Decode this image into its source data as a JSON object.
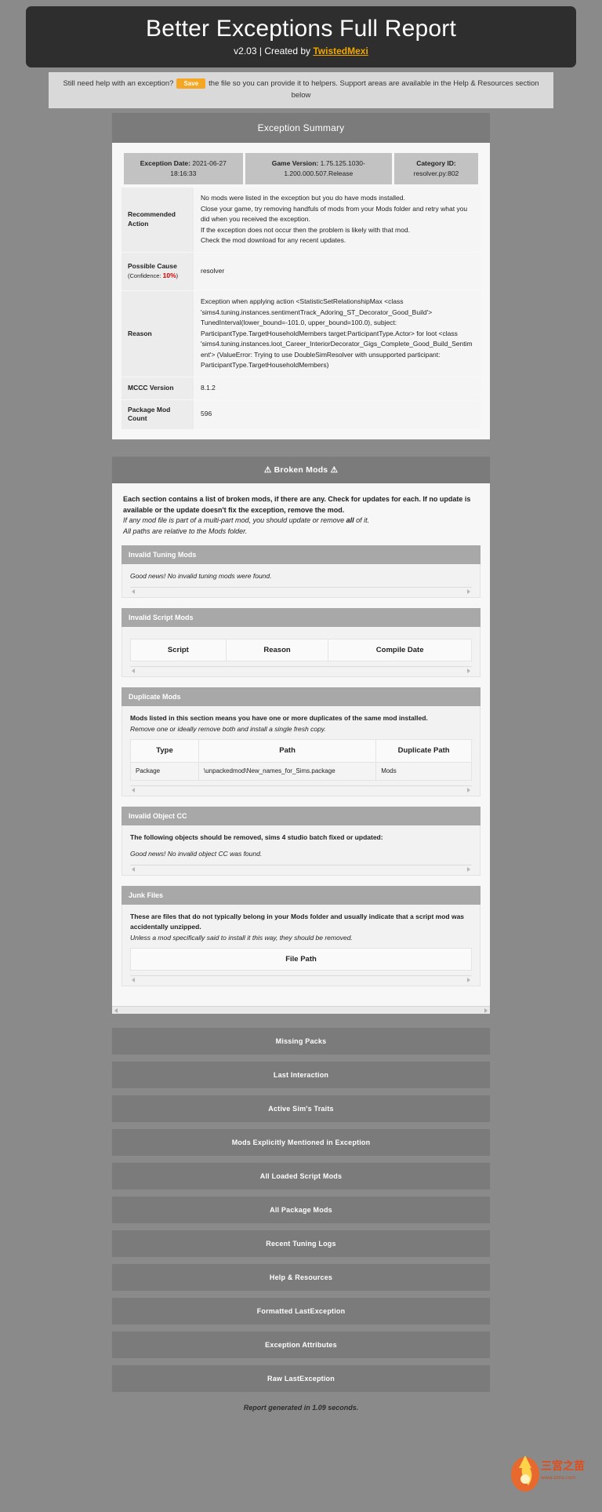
{
  "banner": {
    "title": "Better Exceptions Full Report",
    "version": "v2.03 | Created by ",
    "author": "TwistedMexi"
  },
  "help_strip": {
    "text_before": "Still need help with an exception?",
    "save_label": "Save",
    "text_after": "the file so you can provide it to helpers. Support areas are available in the Help & Resources section below"
  },
  "summary": {
    "heading": "Exception Summary",
    "meta": [
      {
        "label": "Exception Date:",
        "value": "2021-06-27 18:16:33"
      },
      {
        "label": "Game Version:",
        "value": "1.75.125.1030-1.200.000.507.Release"
      },
      {
        "label": "Category ID:",
        "value": "resolver.py:802"
      }
    ],
    "rows": [
      {
        "label": "Recommended Action",
        "value": "No mods were listed in the exception but you do have mods installed.\nClose your game, try removing handfuls of mods from your Mods folder and retry what you did when you received the exception.\nIf the exception does not occur then the problem is likely with that mod.\nCheck the mod download for any recent updates."
      },
      {
        "label": "Possible Cause",
        "label_sub": "(Confidence: ",
        "label_pct": "10%",
        "label_sub_end": ")",
        "value": "resolver"
      },
      {
        "label": "Reason",
        "value": "Exception when applying action <StatisticSetRelationshipMax <class 'sims4.tuning.instances.sentimentTrack_Adoring_ST_Decorator_Good_Build'> TunedInterval(lower_bound=-101.0, upper_bound=100.0), subject: ParticipantType.TargetHouseholdMembers target:ParticipantType.Actor> for loot <class 'sims4.tuning.instances.loot_Career_InteriorDecorator_Gigs_Complete_Good_Build_Sentiment'> (ValueError: Trying to use DoubleSimResolver with unsupported participant: ParticipantType.TargetHouseholdMembers)"
      },
      {
        "label": "MCCC Version",
        "value": "8.1.2"
      },
      {
        "label": "Package Mod Count",
        "value": "596"
      }
    ]
  },
  "broken_mods": {
    "heading": "⚠️ Broken Mods ⚠️",
    "heading_text": "Broken Mods",
    "warning_icon": "warning-triangle-icon",
    "intro_bold": "Each section contains a list of broken mods, if there are any. Check for updates for each. If no update is available or the update doesn't fix the exception, remove the mod.",
    "intro_italic_1_a": "If any mod file is part of a multi-part mod, you should update or remove ",
    "intro_italic_1_b": "all",
    "intro_italic_1_c": " of it.",
    "intro_italic_2": "All paths are relative to the Mods folder.",
    "subpanels": [
      {
        "title": "Invalid Tuning Mods",
        "message_italic": "Good news! No invalid tuning mods were found.",
        "table": null
      },
      {
        "title": "Invalid Script Mods",
        "message_italic": null,
        "table": {
          "headers": [
            "Script",
            "Reason",
            "Compile Date"
          ],
          "rows": []
        }
      },
      {
        "title": "Duplicate Mods",
        "message_bold": "Mods listed in this section means you have one or more duplicates of the same mod installed.",
        "message_italic": "Remove one or ideally remove both and install a single fresh copy.",
        "table": {
          "headers": [
            "Type",
            "Path",
            "Duplicate Path"
          ],
          "rows": [
            [
              "Package",
              "\\unpackedmod\\New_names_for_Sims.package",
              "Mods"
            ]
          ]
        }
      },
      {
        "title": "Invalid Object CC",
        "message_bold": "The following objects should be removed, sims 4 studio batch fixed or updated:",
        "message_italic": "Good news! No invalid object CC was found.",
        "table": null
      },
      {
        "title": "Junk Files",
        "message_bold": "These are files that do not typically belong in your Mods folder and usually indicate that a script mod was accidentally unzipped.",
        "message_italic": "Unless a mod specifically said to install it this way, they should be removed.",
        "table": {
          "headers": [
            "File Path"
          ],
          "rows": []
        }
      }
    ]
  },
  "sections": [
    "Missing Packs",
    "Last Interaction",
    "Active Sim's Traits",
    "Mods Explicitly Mentioned in Exception",
    "All Loaded Script Mods",
    "All Package Mods",
    "Recent Tuning Logs",
    "Help & Resources",
    "Formatted LastException",
    "Exception Attributes",
    "Raw LastException"
  ],
  "footer": "Report generated in 1.09 seconds.",
  "colors": {
    "banner_bg": "#2e2e2e",
    "accent_orange": "#f0a500",
    "save_button": "#f5a623",
    "panel_head": "#7b7b7b",
    "subpanel_head": "#a8a8a8",
    "confidence_red": "#cc0000",
    "page_bg": "#8a8a8a"
  }
}
